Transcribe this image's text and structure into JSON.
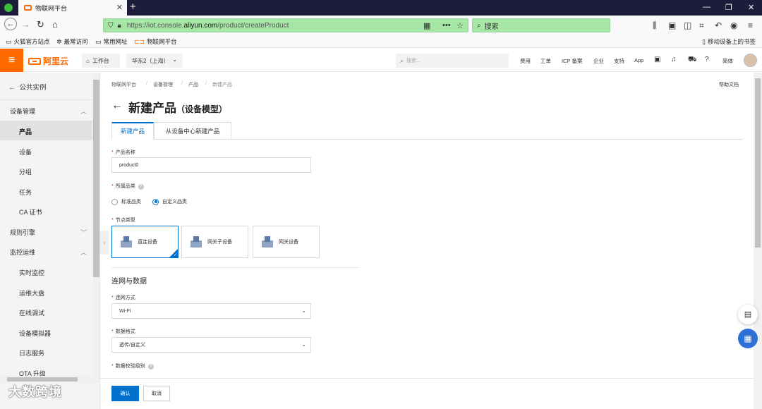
{
  "browser": {
    "tab_title": "物联网平台",
    "tab_close": "✕",
    "new_tab": "+",
    "url_prefix": "https://iot.console.",
    "url_domain": "aliyun.com",
    "url_path": "/product/createProduct",
    "search_placeholder": "搜索",
    "bookmarks": [
      "火狐官方站点",
      "最常访问",
      "常用网址",
      "物联网平台"
    ],
    "mobile_bookmarks": "移动设备上的书签",
    "win_min": "—",
    "win_max": "❐",
    "win_close": "✕"
  },
  "header": {
    "logo_text": "阿里云",
    "workbench": "工作台",
    "region": "华东2（上海）",
    "search_placeholder": "搜索...",
    "links": [
      "费用",
      "工单",
      "ICP 备案",
      "企业",
      "支持",
      "App"
    ],
    "lang": "简体"
  },
  "sidebar": {
    "back_label": "公共实例",
    "groups": [
      {
        "label": "设备管理",
        "expanded": true
      },
      {
        "label": "规则引擎",
        "expanded": false
      },
      {
        "label": "监控运维",
        "expanded": true
      }
    ],
    "items_device": [
      "产品",
      "设备",
      "分组",
      "任务",
      "CA 证书"
    ],
    "items_ops": [
      "实时监控",
      "运维大盘",
      "在线调试",
      "设备模拟器",
      "日志服务",
      "OTA 升级"
    ],
    "active": "产品"
  },
  "breadcrumb": [
    "物联网平台",
    "设备管理",
    "产品",
    "新建产品"
  ],
  "help_doc": "帮助文档",
  "page": {
    "title": "新建产品",
    "subtitle": "（设备模型）",
    "tabs": [
      "新建产品",
      "从设备中心新建产品"
    ]
  },
  "form": {
    "product_name_label": "产品名称",
    "product_name_value": "product0",
    "category_label": "所属品类",
    "category_options": [
      "标准品类",
      "自定义品类"
    ],
    "category_selected": "自定义品类",
    "node_type_label": "节点类型",
    "node_types": [
      "直连设备",
      "网关子设备",
      "网关设备"
    ],
    "node_type_selected": "直连设备",
    "section_network": "连网与数据",
    "network_label": "连网方式",
    "network_value": "Wi-Fi",
    "data_format_label": "数据格式",
    "data_format_value": "透传/自定义",
    "check_level_label": "数据校验级别",
    "required_mark": "*"
  },
  "footer": {
    "ok": "确认",
    "cancel": "取消"
  },
  "watermark": "大数跨境"
}
